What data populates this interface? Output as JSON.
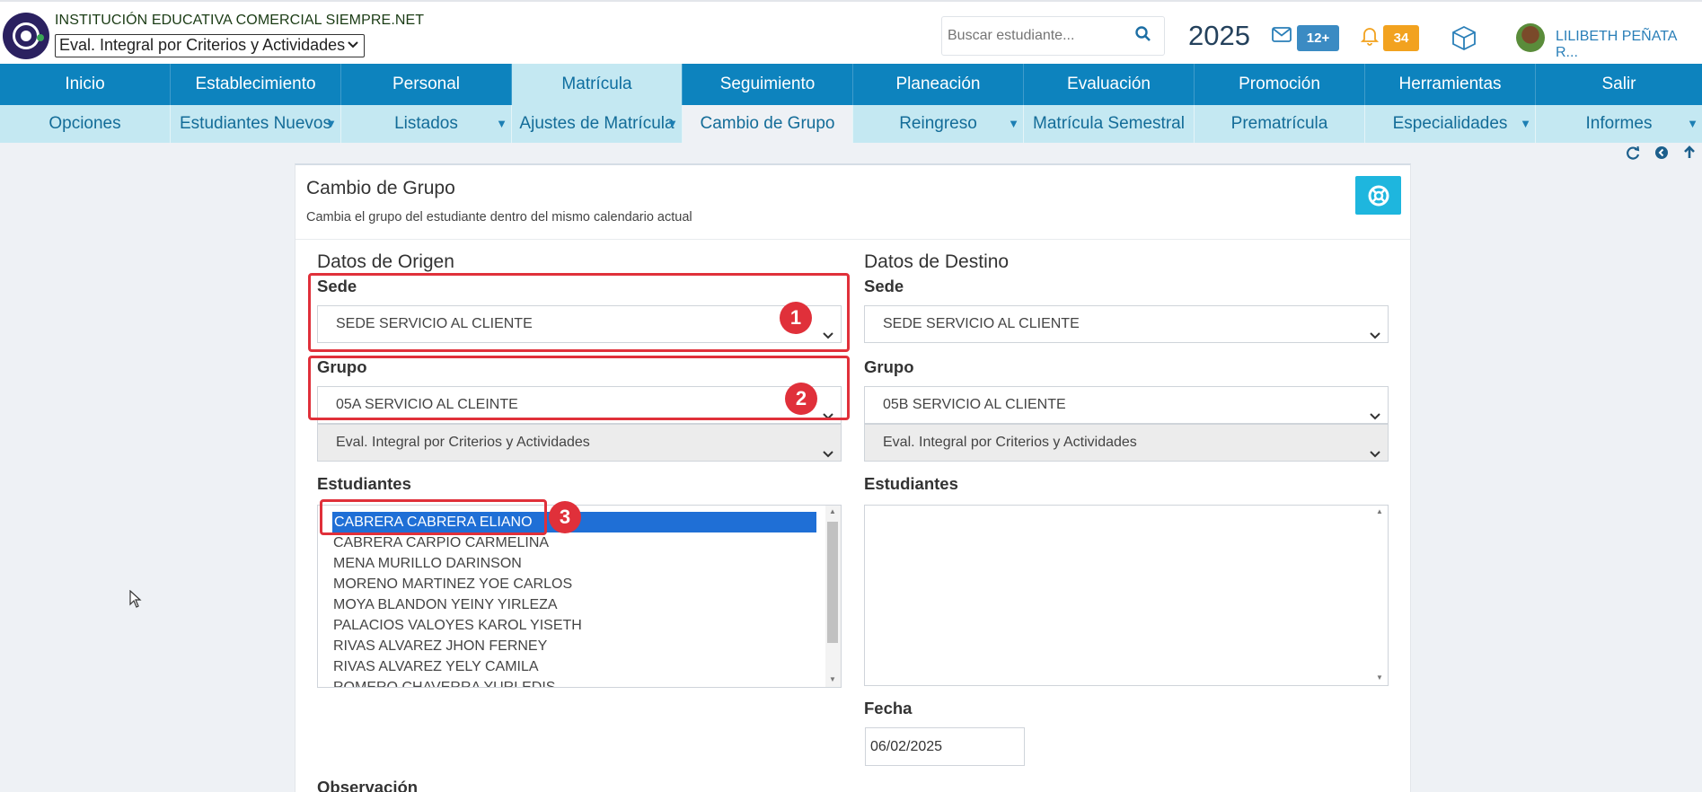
{
  "header": {
    "institution": "INSTITUCIÓN EDUCATIVA COMERCIAL SIEMPRE.NET",
    "eval_select": "Eval. Integral por Criterios y Actividades",
    "search_placeholder": "Buscar estudiante...",
    "year": "2025",
    "mail_badge": "12+",
    "notif_badge": "34",
    "user_name": "LILIBETH PEÑATA R..."
  },
  "main_nav": [
    "Inicio",
    "Establecimiento",
    "Personal",
    "Matrícula",
    "Seguimiento",
    "Planeación",
    "Evaluación",
    "Promoción",
    "Herramientas",
    "Salir"
  ],
  "main_nav_active": "Matrícula",
  "sub_nav": [
    {
      "label": "Opciones",
      "dropdown": false
    },
    {
      "label": "Estudiantes Nuevos",
      "dropdown": true
    },
    {
      "label": "Listados",
      "dropdown": true
    },
    {
      "label": "Ajustes de Matrícula",
      "dropdown": true
    },
    {
      "label": "Cambio de Grupo",
      "dropdown": false
    },
    {
      "label": "Reingreso",
      "dropdown": true
    },
    {
      "label": "Matrícula Semestral",
      "dropdown": false
    },
    {
      "label": "Prematrícula",
      "dropdown": false
    },
    {
      "label": "Especialidades",
      "dropdown": true
    },
    {
      "label": "Informes",
      "dropdown": true
    }
  ],
  "sub_nav_active": "Cambio de Grupo",
  "panel": {
    "title": "Cambio de Grupo",
    "subtitle": "Cambia el grupo del estudiante dentro del mismo calendario actual"
  },
  "origin": {
    "heading": "Datos de Origen",
    "sede_label": "Sede",
    "sede_value": "SEDE SERVICIO AL CLIENTE",
    "grupo_label": "Grupo",
    "grupo_value": "05A SERVICIO AL CLEINTE",
    "eval_value": "Eval. Integral por Criterios y Actividades",
    "students_label": "Estudiantes",
    "students": [
      "CABRERA CABRERA ELIANO",
      "CABRERA CARPIO CARMELINA",
      "MENA MURILLO DARINSON",
      "MORENO MARTINEZ YOE CARLOS",
      "MOYA BLANDON YEINY YIRLEZA",
      "PALACIOS VALOYES KAROL YISETH",
      "RIVAS ALVAREZ JHON FERNEY",
      "RIVAS ALVAREZ YELY CAMILA",
      "ROMERO CHAVERRA YURLEDIS"
    ],
    "selected_student": "CABRERA CABRERA ELIANO",
    "observation_label": "Observación"
  },
  "destination": {
    "heading": "Datos de Destino",
    "sede_label": "Sede",
    "sede_value": "SEDE SERVICIO AL CLIENTE",
    "grupo_label": "Grupo",
    "grupo_value": "05B SERVICIO AL CLIENTE",
    "eval_value": "Eval. Integral por Criterios y Actividades",
    "students_label": "Estudiantes",
    "date_label": "Fecha",
    "date_value": "06/02/2025"
  },
  "annotations": [
    "1",
    "2",
    "3"
  ],
  "colors": {
    "nav_bg": "#0d83be",
    "subnav_bg": "#c4e8f2",
    "selection": "#1f6fd6",
    "annotation_red": "#e0303a",
    "help_button": "#1eb6de"
  }
}
